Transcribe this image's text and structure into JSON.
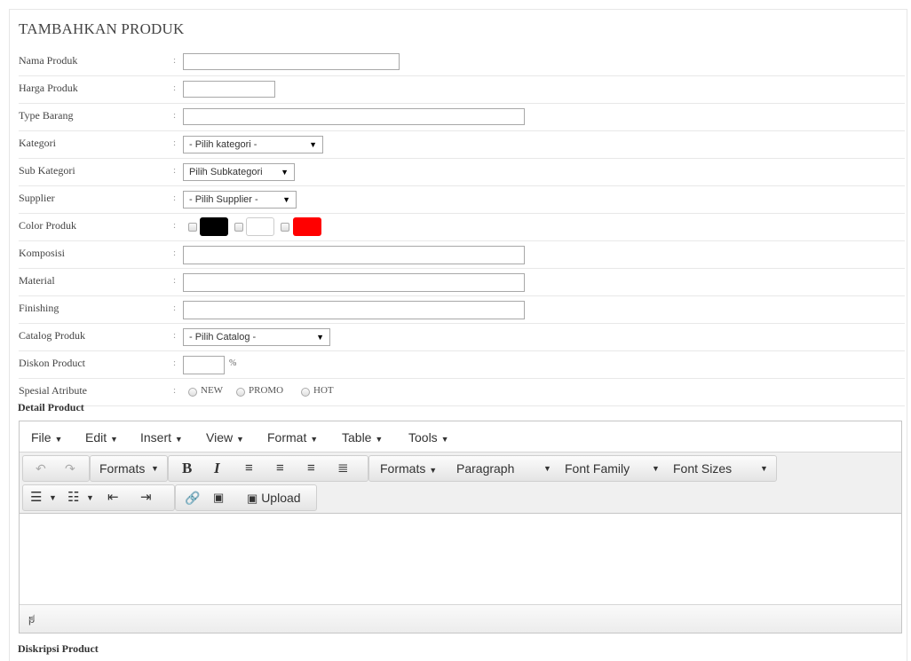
{
  "page": {
    "title": "TAMBAHKAN PRODUK"
  },
  "fields": {
    "nama": {
      "label": "Nama Produk",
      "colon": ":",
      "value": ""
    },
    "harga": {
      "label": "Harga Produk",
      "colon": ":",
      "value": ""
    },
    "type": {
      "label": "Type Barang",
      "colon": ":",
      "value": ""
    },
    "kategori": {
      "label": "Kategori",
      "colon": ":",
      "selected": "- Pilih kategori -"
    },
    "subkategori": {
      "label": "Sub Kategori",
      "colon": ":",
      "selected": "Pilih Subkategori"
    },
    "supplier": {
      "label": "Supplier",
      "colon": ":",
      "selected": "- Pilih Supplier -"
    },
    "color": {
      "label": "Color Produk",
      "colon": ":",
      "swatches": [
        "#000000",
        "#ffffff",
        "#ff0000"
      ]
    },
    "komposisi": {
      "label": "Komposisi",
      "colon": ":",
      "value": ""
    },
    "material": {
      "label": "Material",
      "colon": ":",
      "value": ""
    },
    "finishing": {
      "label": "Finishing",
      "colon": ":",
      "value": ""
    },
    "catalog": {
      "label": "Catalog Produk",
      "colon": ":",
      "selected": "- Pilih Catalog -"
    },
    "diskon": {
      "label": "Diskon Product",
      "colon": ":",
      "value": "",
      "unit": "%"
    },
    "spesial": {
      "label": "Spesial Atribute",
      "colon": ":",
      "options": [
        "NEW",
        "PROMO",
        "HOT"
      ]
    }
  },
  "detail": {
    "label": "Detail Product"
  },
  "editor": {
    "menu": [
      "File",
      "Edit",
      "Insert",
      "View",
      "Format",
      "Table",
      "Tools"
    ],
    "toolbar": {
      "formats1": "Formats",
      "formats2": "Formats",
      "paragraph": "Paragraph",
      "font_family": "Font Family",
      "font_sizes": "Font Sizes",
      "upload": "Upload",
      "bold": "B",
      "italic": "I"
    },
    "status_path": "p"
  },
  "diskripsi": {
    "label": "Diskripsi Product"
  }
}
